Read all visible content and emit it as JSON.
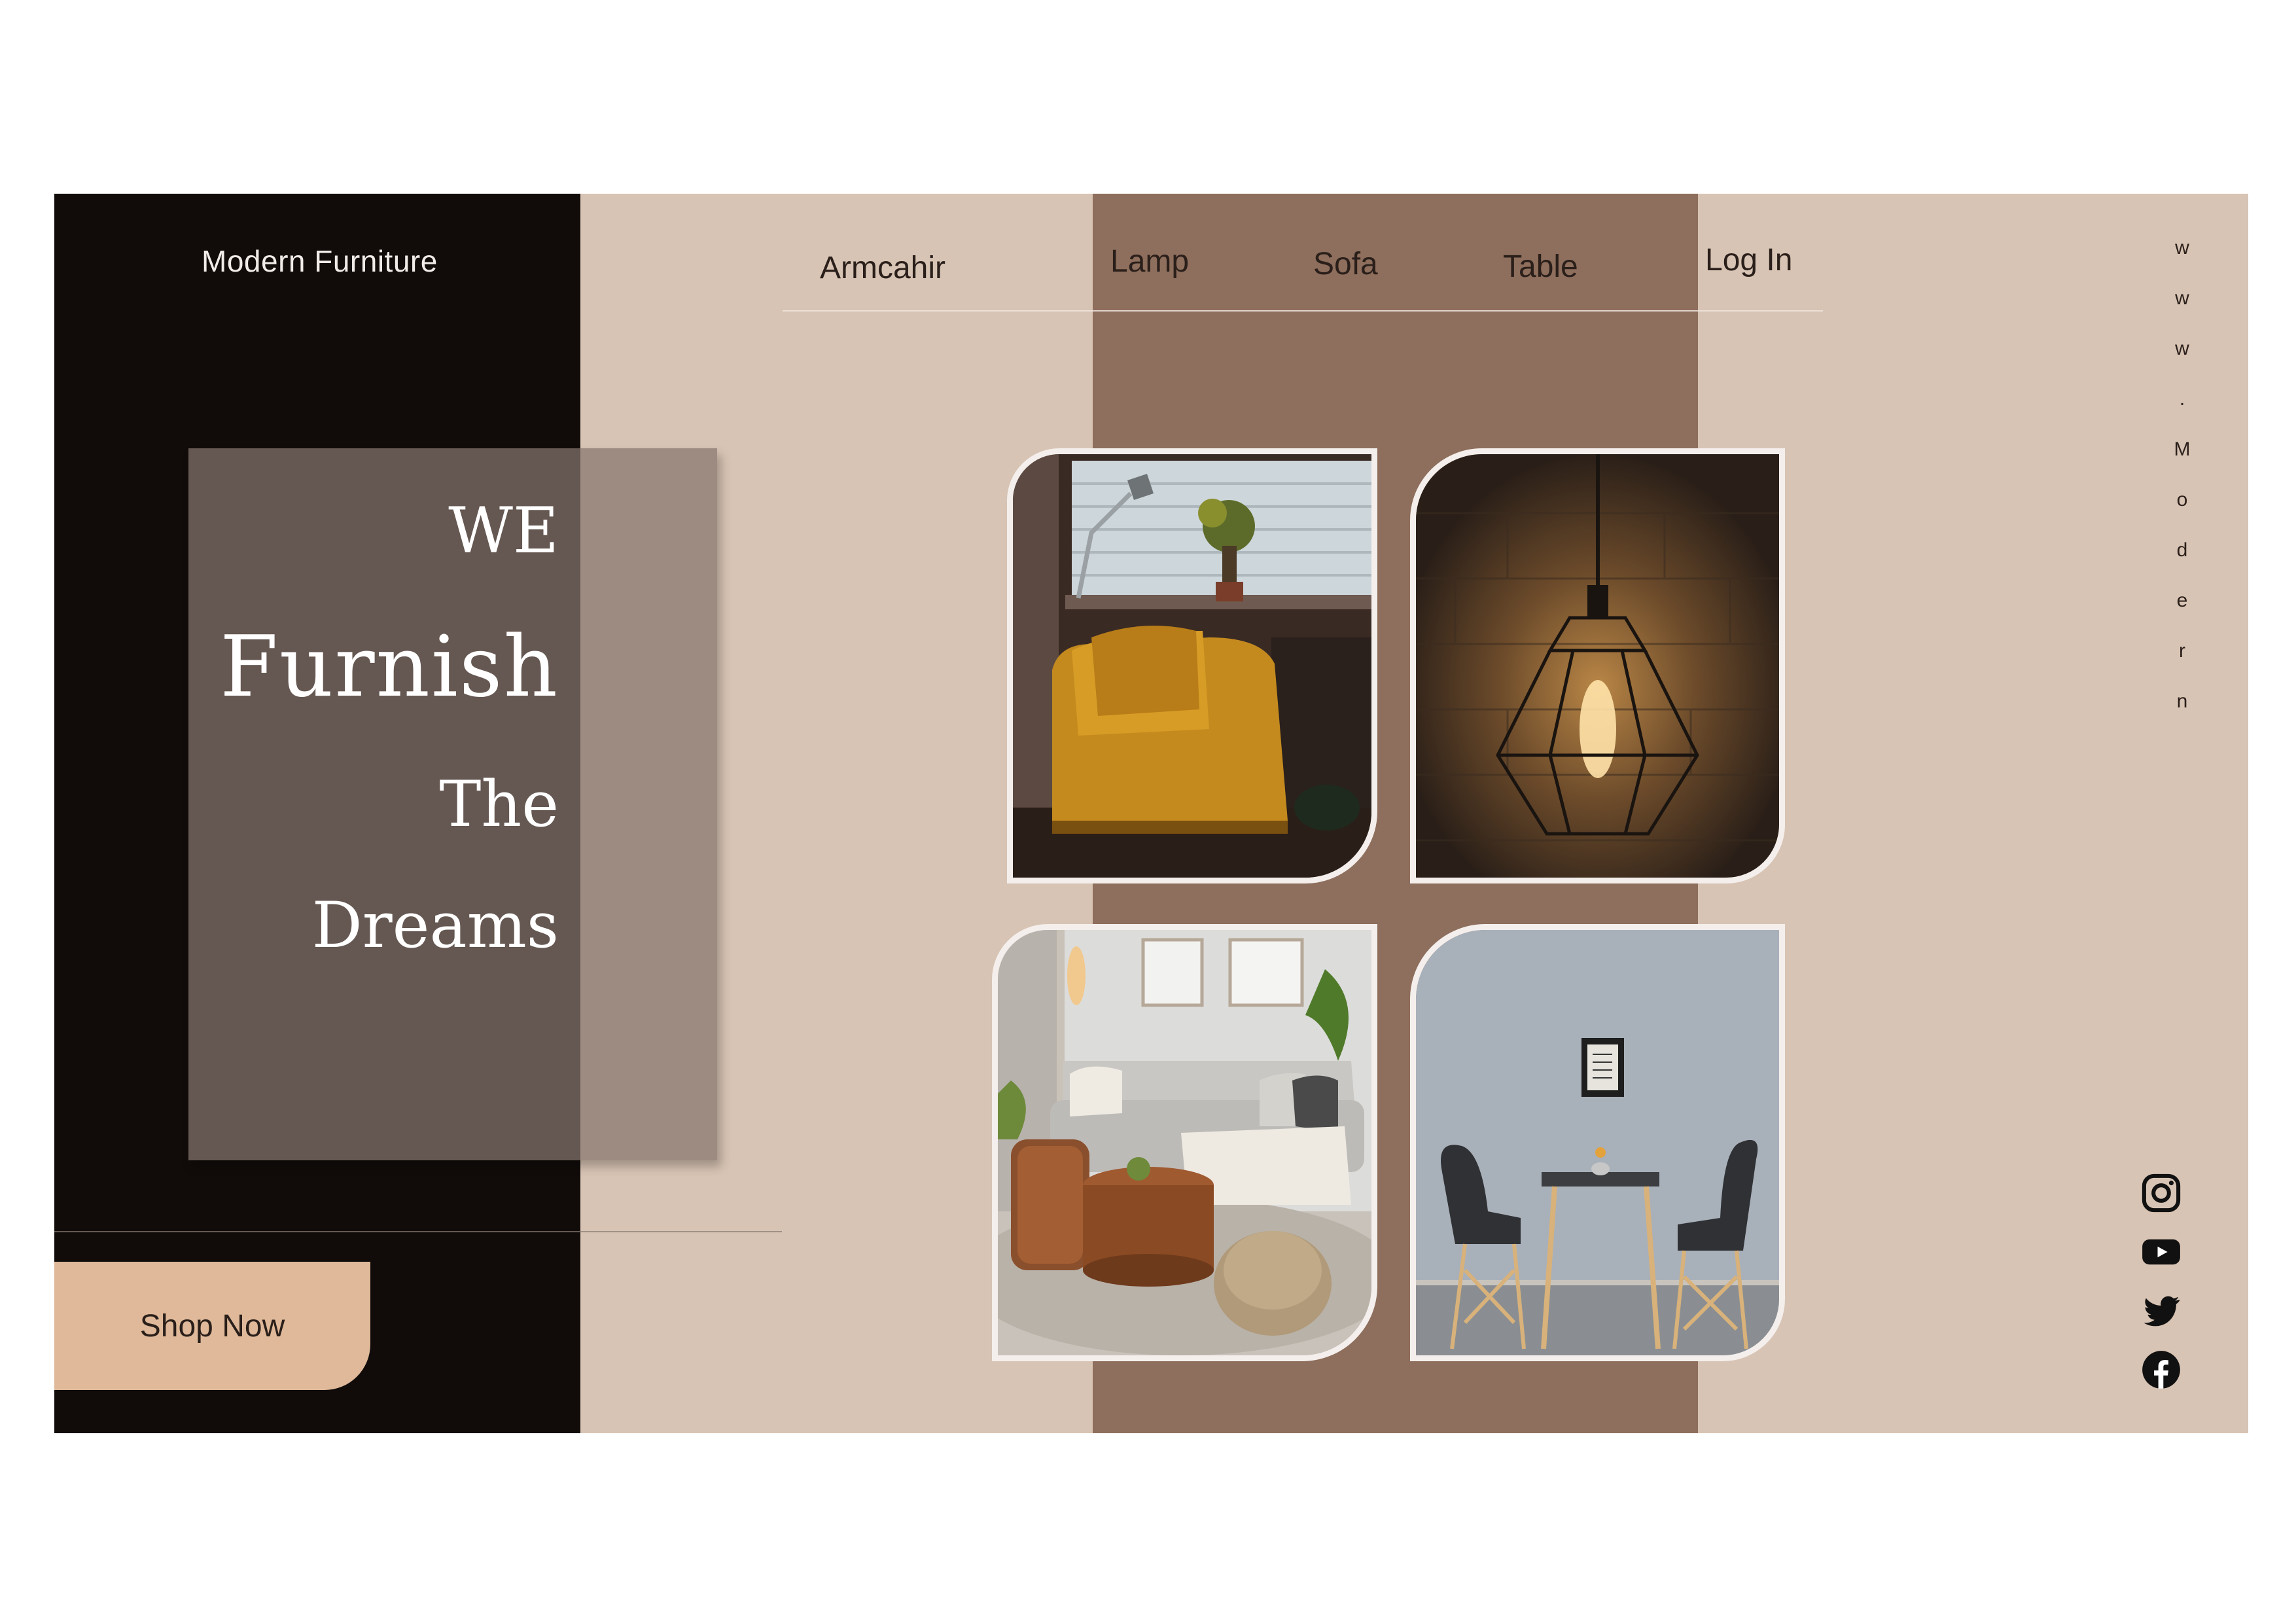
{
  "brand": {
    "name": "Modern Furniture"
  },
  "nav": {
    "items": [
      "Armcahir",
      "Lamp",
      "Sofa",
      "Table"
    ],
    "login": "Log In"
  },
  "hero": {
    "line1": "WE",
    "line2": "Furnish",
    "line3": "The",
    "line4": "Dreams"
  },
  "cta": {
    "label": "Shop Now"
  },
  "side_text": [
    "w",
    "w",
    "w",
    ".",
    "M",
    "o",
    "d",
    "e",
    "r",
    "n"
  ],
  "social": [
    "instagram-icon",
    "youtube-icon",
    "twitter-icon",
    "facebook-icon"
  ],
  "colors": {
    "background": "#d8c4b4",
    "dark_panel": "#110c0a",
    "brown_band": "#8e6e5c",
    "button": "#dfb999"
  }
}
